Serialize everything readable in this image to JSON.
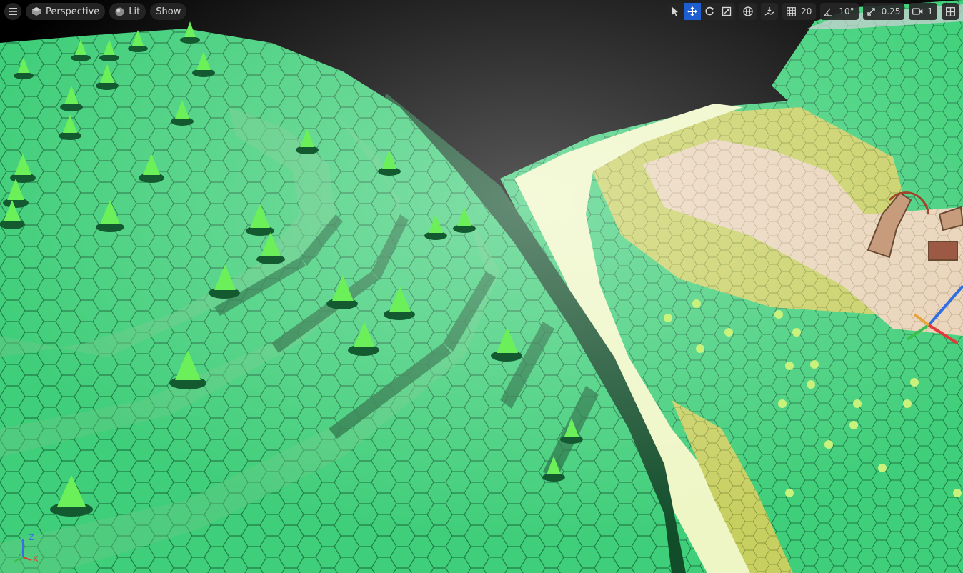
{
  "toolbar": {
    "menu_icon": "hamburger-icon",
    "view_mode": "Perspective",
    "lighting": "Lit",
    "show": "Show",
    "grid_snap": "20",
    "rotation_snap": "10°",
    "scale_snap": "0.25",
    "camera_speed": "1"
  },
  "gizmo": {
    "x": "X",
    "z": "Z"
  },
  "colors": {
    "accent": "#1d5fd0",
    "grass": "#3fce79",
    "grass_dark": "#2aa85d",
    "meadow": "#c8cf61",
    "sand": "#e8d3b8",
    "path": "#eef6c5"
  }
}
